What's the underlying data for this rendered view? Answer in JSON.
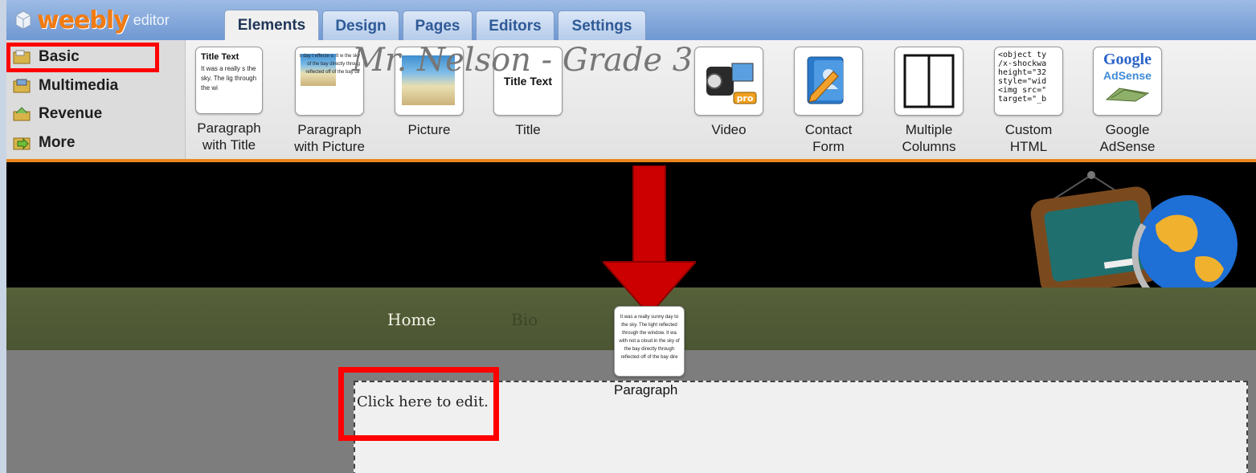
{
  "app": {
    "brand": "weebly",
    "subtitle": "editor"
  },
  "tabs": [
    {
      "label": "Elements",
      "active": true
    },
    {
      "label": "Design",
      "active": false
    },
    {
      "label": "Pages",
      "active": false
    },
    {
      "label": "Editors",
      "active": false
    },
    {
      "label": "Settings",
      "active": false
    }
  ],
  "categories": [
    {
      "label": "Basic",
      "icon": "basic-folder-icon",
      "highlighted": true
    },
    {
      "label": "Multimedia",
      "icon": "multimedia-folder-icon"
    },
    {
      "label": "Revenue",
      "icon": "revenue-icon"
    },
    {
      "label": "More",
      "icon": "more-arrow-icon"
    }
  ],
  "elements": [
    {
      "label1": "Paragraph",
      "label2": "with Title",
      "icon": "paragraph-with-title-icon",
      "thumb_title": "Title Text",
      "thumb_text": "It was a really s the sky. The lig through the wi"
    },
    {
      "label1": "Paragraph",
      "label2": "with Picture",
      "icon": "paragraph-with-picture-icon",
      "thumb_text": "s day t effecte o. It w the sky of the bay directly throug reflected off of the bay dir"
    },
    {
      "label1": "Picture",
      "label2": "",
      "icon": "picture-icon"
    },
    {
      "label1": "Title",
      "label2": "",
      "icon": "title-icon",
      "thumb_title": "Title Text"
    },
    {
      "label1": "Video",
      "label2": "",
      "icon": "video-camera-icon",
      "badge": "pro"
    },
    {
      "label1": "Contact",
      "label2": "Form",
      "icon": "contact-form-icon"
    },
    {
      "label1": "Multiple",
      "label2": "Columns",
      "icon": "multiple-columns-icon"
    },
    {
      "label1": "Custom",
      "label2": "HTML",
      "icon": "custom-html-icon",
      "code": "<object ty\n/x-shockwa\nheight=\"32\nstyle=\"wid\n<img src=\"\ntarget=\"_b"
    },
    {
      "label1": "Google",
      "label2": "AdSense",
      "icon": "google-adsense-icon",
      "logo_top": "Google",
      "logo_bottom": "AdSense"
    }
  ],
  "site": {
    "title": "Mr. Nelson - Grade 3",
    "nav": [
      {
        "label": "Home",
        "color": "#f4f4e8"
      },
      {
        "label": "Bio",
        "color": "#3f4528"
      }
    ],
    "placeholder": "Click here to edit."
  },
  "drag": {
    "label": "Paragraph",
    "thumb_text": "It was a really sunny day to the sky. The light reflected through the window. It wa with not a cloud in the sky of the bay directly through reflected off of the bay dire"
  },
  "colors": {
    "accent": "#e8861d",
    "highlight": "#ff0000",
    "arrow": "#cc0000",
    "nav_bg": "#566039"
  }
}
